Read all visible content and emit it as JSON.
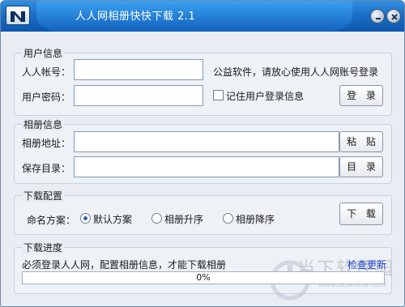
{
  "window": {
    "title": "人人网相册快快下载 2.1"
  },
  "user_info": {
    "group_title": "用户信息",
    "account_label": "人人帐号：",
    "account_value": "",
    "notice": "公益软件，请放心使用人人网账号登录",
    "password_label": "用户密码：",
    "password_value": "",
    "remember_label": "记住用户登录信息",
    "remember_checked": false,
    "login_button": "登 录"
  },
  "album_info": {
    "group_title": "相册信息",
    "address_label": "相册地址：",
    "address_value": "",
    "paste_button": "粘 贴",
    "save_dir_label": "保存目录：",
    "save_dir_value": "",
    "dir_button": "目 录"
  },
  "download_config": {
    "group_title": "下载配置",
    "naming_label": "命名方案：",
    "options": [
      "默认方案",
      "相册升序",
      "相册降序"
    ],
    "selected_option": "默认方案",
    "download_button": "下 载"
  },
  "download_progress": {
    "group_title": "下载进度",
    "status_text": "必须登录人人网，配置相册信息，才能下载相册",
    "update_link": "检查更新",
    "progress_percent": 0,
    "progress_text": "0%"
  },
  "watermark": {
    "brand_text": "当下软件园",
    "url": "www.downxia.com"
  },
  "colors": {
    "titlebar": "#1a6cc3",
    "window_bg": "#e9edf3",
    "link": "#1a3fcc",
    "progress_fill": "#3c8be0"
  }
}
